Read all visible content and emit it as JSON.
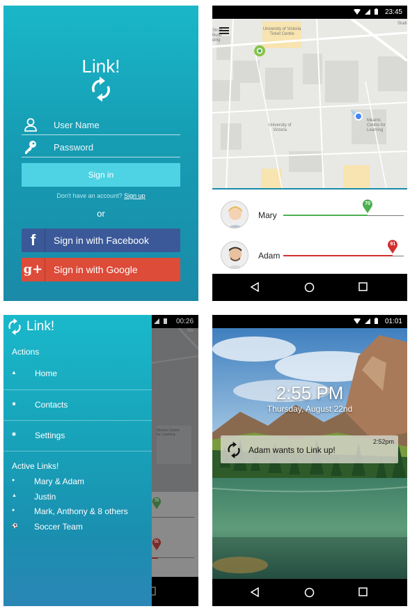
{
  "login": {
    "title": "Link!",
    "username_placeholder": "User Name",
    "password_placeholder": "Password",
    "signin_label": "Sign in",
    "no_account_text": "Don't have an account?",
    "signup_label": "Sign up",
    "or_text": "or",
    "facebook_label": "Sign in with Facebook",
    "google_label": "Sign in with Google",
    "facebook_icon_text": "f",
    "google_icon_text": "g+",
    "colors": {
      "facebook": "#3b5998",
      "google": "#dd4b39",
      "signin": "#4dd3e4"
    }
  },
  "map_screen": {
    "status_time": "23:45",
    "map_labels": {
      "ticket_centre": "University of Victoria Ticket Centre",
      "university": "University of Victoria",
      "mearns": "Mearns Centre for Learning",
      "left_edge": "Stron Build ding",
      "studio": "Studi"
    },
    "people": [
      {
        "name": "Mary",
        "value": 70,
        "color": "#4caf50"
      },
      {
        "name": "Adam",
        "value": 91,
        "color": "#d32f2f"
      }
    ]
  },
  "drawer": {
    "status_time": "00:26",
    "title": "Link!",
    "actions_header": "Actions",
    "menu": [
      {
        "label": "Home",
        "icon": "home-icon"
      },
      {
        "label": "Contacts",
        "icon": "contacts-icon"
      },
      {
        "label": "Settings",
        "icon": "settings-icon"
      }
    ],
    "active_header": "Active Links!",
    "links": [
      {
        "label": "Mary & Adam",
        "icon": "group-icon"
      },
      {
        "label": "Justin",
        "icon": "person-icon"
      },
      {
        "label": "Mark, Anthony & 8 others",
        "icon": "group-icon"
      },
      {
        "label": "Soccer Team",
        "icon": "soccer-icon"
      }
    ],
    "bg_pins": [
      "70",
      "91"
    ],
    "bg_map_label": "Mearns Centre for Learning",
    "bg_status_label": "Stu"
  },
  "lock_screen": {
    "status_time": "01:01",
    "clock": "2:55 PM",
    "date": "Thursday, August 22nd",
    "notification_text": "Adam wants to Link up!",
    "notification_time": "2:52pm"
  }
}
